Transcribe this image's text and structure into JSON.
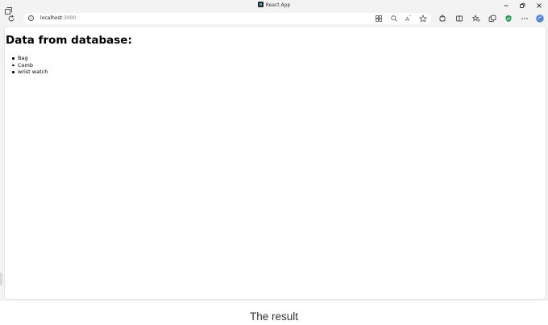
{
  "browser": {
    "tab_title": "React App",
    "address": {
      "host": "localhost",
      "port": ":3000"
    },
    "toolbar_icons": [
      "refresh-icon",
      "site-info-icon",
      "app-available-icon",
      "zoom-icon",
      "read-aloud-icon",
      "favorite-icon",
      "extensions-icon",
      "split-screen-icon",
      "favorites-icon",
      "collections-icon",
      "browser-essentials-icon",
      "more-icon",
      "copilot-icon"
    ],
    "window_controls": [
      "minimize-icon",
      "restore-icon",
      "close-icon"
    ]
  },
  "page": {
    "heading": "Data from database:",
    "items": [
      "Bag",
      "Comb",
      "wrist watch"
    ]
  },
  "caption": "The result"
}
